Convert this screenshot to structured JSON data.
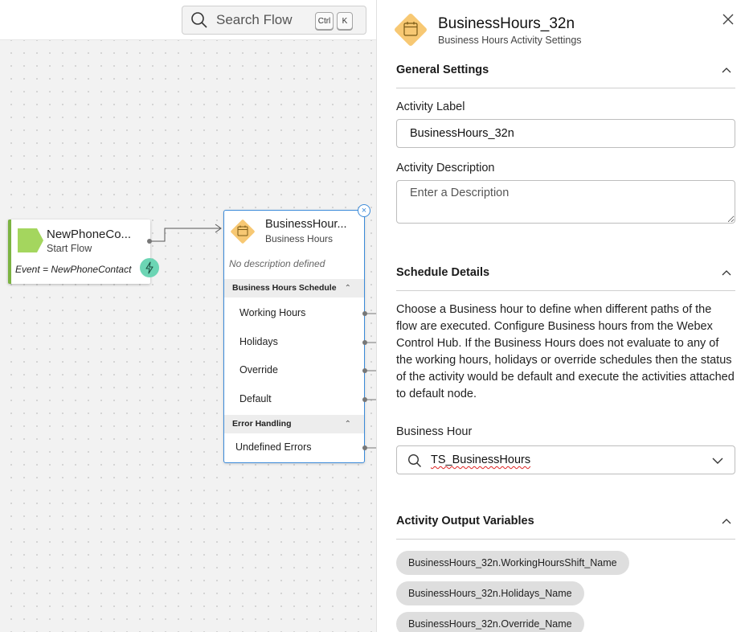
{
  "canvas": {
    "search": {
      "label": "Search Flow",
      "key_ctrl": "Ctrl",
      "key_k": "K"
    },
    "start_node": {
      "title": "NewPhoneCo...",
      "subtitle": "Start Flow",
      "event": "Event = NewPhoneContact"
    },
    "bh_node": {
      "title": "BusinessHour...",
      "subtitle": "Business Hours",
      "description": "No description defined",
      "schedule_section": "Business Hours Schedule",
      "schedule_items": [
        "Working Hours",
        "Holidays",
        "Override",
        "Default"
      ],
      "error_section": "Error Handling",
      "error_items": [
        "Undefined Errors"
      ]
    }
  },
  "panel": {
    "title": "BusinessHours_32n",
    "subtitle": "Business Hours Activity Settings",
    "general": {
      "heading": "General Settings",
      "label_field": "Activity Label",
      "label_value": "BusinessHours_32n",
      "desc_field": "Activity Description",
      "desc_placeholder": "Enter a Description"
    },
    "schedule": {
      "heading": "Schedule Details",
      "text": "Choose a Business hour to define when different paths of the flow are executed. Configure Business hours from the Webex Control Hub. If the Business Hours does not evaluate to any of the working hours, holidays or override schedules then the status of the activity would be default and execute the activities attached to default node.",
      "bh_label": "Business Hour",
      "bh_value": "TS_BusinessHours"
    },
    "output": {
      "heading": "Activity Output Variables",
      "chips": [
        "BusinessHours_32n.WorkingHoursShift_Name",
        "BusinessHours_32n.Holidays_Name",
        "BusinessHours_32n.Override_Name"
      ]
    }
  },
  "colors": {
    "accent": "#3b8ad9",
    "start_green": "#7cb342",
    "bh_yellow": "#f7c873",
    "bolt_teal": "#6cd5b4"
  },
  "icons": [
    "search-icon",
    "calendar-icon",
    "lightning-icon",
    "close-icon",
    "chevron-up-icon",
    "chevron-down-icon"
  ]
}
